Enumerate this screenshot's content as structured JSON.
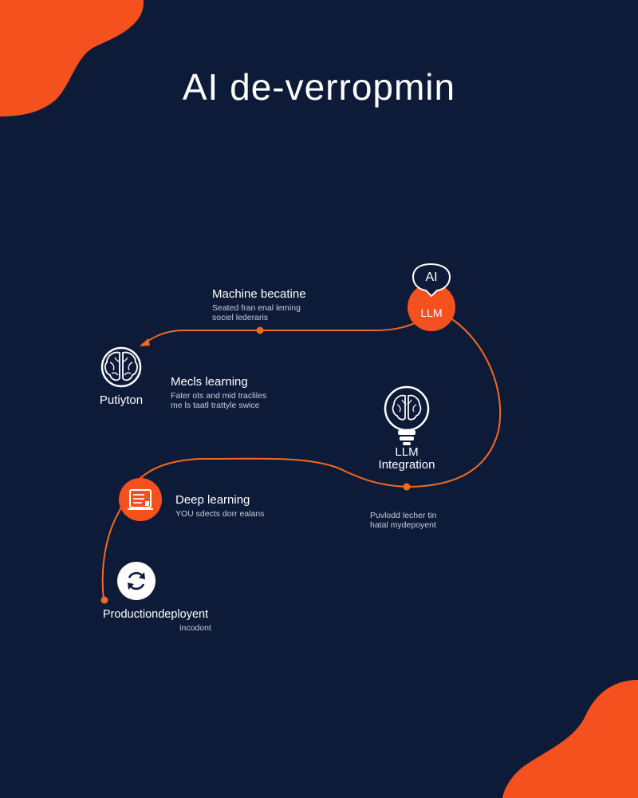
{
  "title": "AI de-verropmin",
  "colors": {
    "background": "#0d1b38",
    "accent": "#f4511e",
    "line": "#f46a1e",
    "text": "#ffffff"
  },
  "nodes": {
    "ai_badge": {
      "bubble_text": "AI",
      "circle_text": "LLM"
    },
    "python": {
      "label": "Putiyton",
      "icon": "brain-icon"
    },
    "llm_integration": {
      "label_line1": "LLM",
      "label_line2": "Integration",
      "icon": "lightbulb-brain-icon"
    },
    "deep_learning": {
      "icon": "document-icon"
    },
    "production": {
      "label": "Productiondeployent",
      "sub": "incodont",
      "icon": "refresh-icon"
    }
  },
  "steps": {
    "machine": {
      "title": "Machine becatine",
      "line1": "Seated fran enal leming",
      "line2": "sociel lederaris"
    },
    "models": {
      "title": "Mecls learning",
      "line1": "Fater ots and mid tracliles",
      "line2": "me ls taatl trattyle swice"
    },
    "deep": {
      "title": "Deep learning",
      "line1": "YOU sdects dorr ealans"
    },
    "deploy": {
      "line1": "Puvlodd lecher tin",
      "line2": "hatal mydepoyent"
    }
  }
}
